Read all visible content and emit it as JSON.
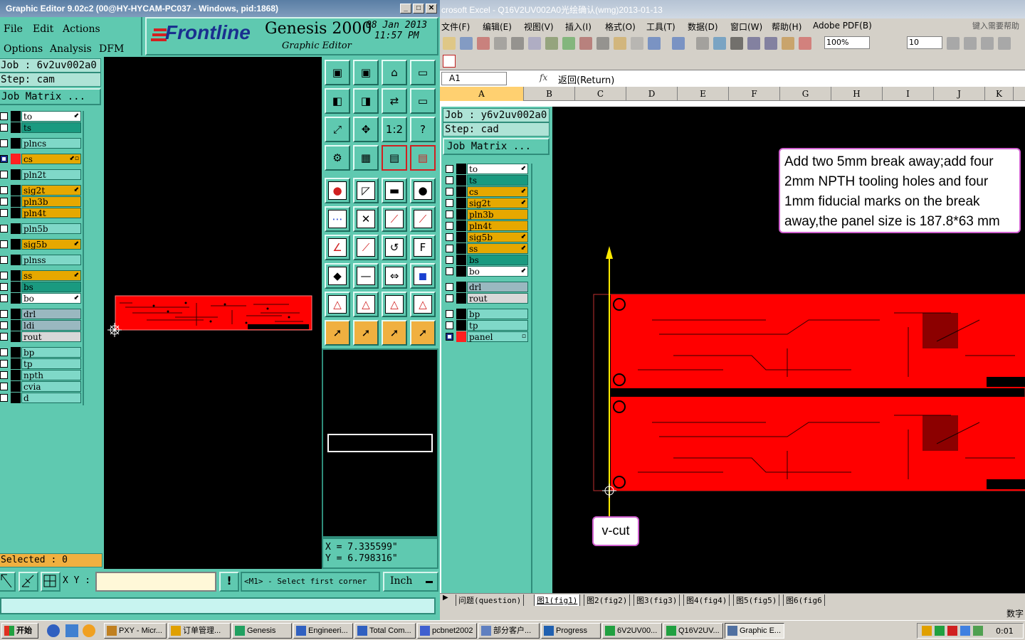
{
  "genesis": {
    "title": "Graphic Editor 9.02c2 (00@HY-HYCAM-PC037 - Windows, pid:1868)",
    "menu": [
      "File",
      "Edit",
      "Actions",
      "Options",
      "Analysis",
      "DFM"
    ],
    "brand": "Frontline",
    "product": "Genesis 2000",
    "subtitle": "Graphic Editor",
    "date": "08 Jan 2013",
    "time": "11:57 PM",
    "job": "Job : 6v2uv002a0",
    "step": "Step: cam",
    "job_matrix": "Job Matrix ...",
    "layers": [
      {
        "name": "to",
        "color": "#ffffff",
        "mark": "⬋"
      },
      {
        "name": "ts",
        "color": "#1a9a80",
        "mark": ""
      },
      {
        "name": "plncs",
        "color": "#7fd8c8",
        "mark": ""
      },
      {
        "name": "cs",
        "color": "#e6a800",
        "mark": "⬋▫",
        "active": true
      },
      {
        "name": "pln2t",
        "color": "#7fd8c8",
        "mark": ""
      },
      {
        "name": "sig2t",
        "color": "#e6a800",
        "mark": "⬋"
      },
      {
        "name": "pln3b",
        "color": "#e6a800",
        "mark": ""
      },
      {
        "name": "pln4t",
        "color": "#e6a800",
        "mark": ""
      },
      {
        "name": "pln5b",
        "color": "#7fd8c8",
        "mark": ""
      },
      {
        "name": "sig5b",
        "color": "#e6a800",
        "mark": "⬋"
      },
      {
        "name": "plnss",
        "color": "#7fd8c8",
        "mark": ""
      },
      {
        "name": "ss",
        "color": "#e6a800",
        "mark": "⬋"
      },
      {
        "name": "bs",
        "color": "#1a9a80",
        "mark": ""
      },
      {
        "name": "bo",
        "color": "#ffffff",
        "mark": "⬋"
      },
      {
        "name": "drl",
        "color": "#9ab8c0",
        "mark": ""
      },
      {
        "name": "ldi",
        "color": "#9ab8c0",
        "mark": ""
      },
      {
        "name": "rout",
        "color": "#d8d8d8",
        "mark": ""
      },
      {
        "name": "bp",
        "color": "#7fd8c8",
        "mark": ""
      },
      {
        "name": "tp",
        "color": "#7fd8c8",
        "mark": ""
      },
      {
        "name": "npth",
        "color": "#7fd8c8",
        "mark": ""
      },
      {
        "name": "cvia",
        "color": "#7fd8c8",
        "mark": ""
      },
      {
        "name": "d",
        "color": "#7fd8c8",
        "mark": ""
      }
    ],
    "selected": "Selected : 0",
    "xy_label": "X Y :",
    "xy_value": "",
    "prompt": "<M1> - Select first corner",
    "units": "Inch",
    "coord_x": "X = 7.335599\"",
    "coord_y": "Y = 6.798316\""
  },
  "excel": {
    "title": "crosoft Excel - Q16V2UV002A0光绘确认(wmg)2013-01-13",
    "menu": [
      "文件(F)",
      "编辑(E)",
      "视图(V)",
      "插入(I)",
      "格式(O)",
      "工具(T)",
      "数据(D)",
      "窗口(W)",
      "帮助(H)",
      "Adobe PDF(B)"
    ],
    "help_prompt": "键入需要帮助",
    "zoom": "100%",
    "font_size": "10",
    "cell_ref": "A1",
    "fx": "fx",
    "formula": "返回(Return)",
    "columns": [
      "A",
      "B",
      "C",
      "D",
      "E",
      "F",
      "G",
      "H",
      "I",
      "J",
      "K"
    ],
    "sheet_tabs": [
      "问题(question)",
      "图1(fig1)",
      "图2(fig2)",
      "图3(fig3)",
      "图4(fig4)",
      "图5(fig5)",
      "图6(fig6"
    ],
    "status_right": "数字",
    "embedded": {
      "job": "Job : y6v2uv002a0",
      "step": "Step: cad",
      "job_matrix": "Job Matrix ...",
      "layers": [
        {
          "name": "to",
          "color": "#ffffff",
          "mark": "⬋"
        },
        {
          "name": "ts",
          "color": "#1a9a80",
          "mark": ""
        },
        {
          "name": "cs",
          "color": "#e6a800",
          "mark": "⬋"
        },
        {
          "name": "sig2t",
          "color": "#e6a800",
          "mark": "⬋"
        },
        {
          "name": "pln3b",
          "color": "#e6a800",
          "mark": ""
        },
        {
          "name": "pln4t",
          "color": "#e6a800",
          "mark": ""
        },
        {
          "name": "sig5b",
          "color": "#e6a800",
          "mark": "⬋"
        },
        {
          "name": "ss",
          "color": "#e6a800",
          "mark": "⬋"
        },
        {
          "name": "bs",
          "color": "#1a9a80",
          "mark": ""
        },
        {
          "name": "bo",
          "color": "#ffffff",
          "mark": "⬋"
        },
        {
          "name": "drl",
          "color": "#9ab8c0",
          "mark": ""
        },
        {
          "name": "rout",
          "color": "#d8d8d8",
          "mark": ""
        },
        {
          "name": "bp",
          "color": "#7fd8c8",
          "mark": ""
        },
        {
          "name": "tp",
          "color": "#7fd8c8",
          "mark": ""
        },
        {
          "name": "panel",
          "color": "#7fd8c8",
          "mark": "▫",
          "active": true
        }
      ],
      "note": "Add two 5mm break away;add four 2mm NPTH tooling holes and four 1mm  fiducial marks on the break away,the panel size is 187.8*63 mm",
      "callout": "v-cut"
    }
  },
  "taskbar": {
    "start": "开始",
    "tasks": [
      "PXY - Micr...",
      "订单管理...",
      "Genesis",
      "Engineeri...",
      "Total Com...",
      "pcbnet2002",
      "部分客户...",
      "Progress",
      "6V2UV00...",
      "Q16V2UV...",
      "Graphic E..."
    ],
    "clock": "0:01"
  }
}
